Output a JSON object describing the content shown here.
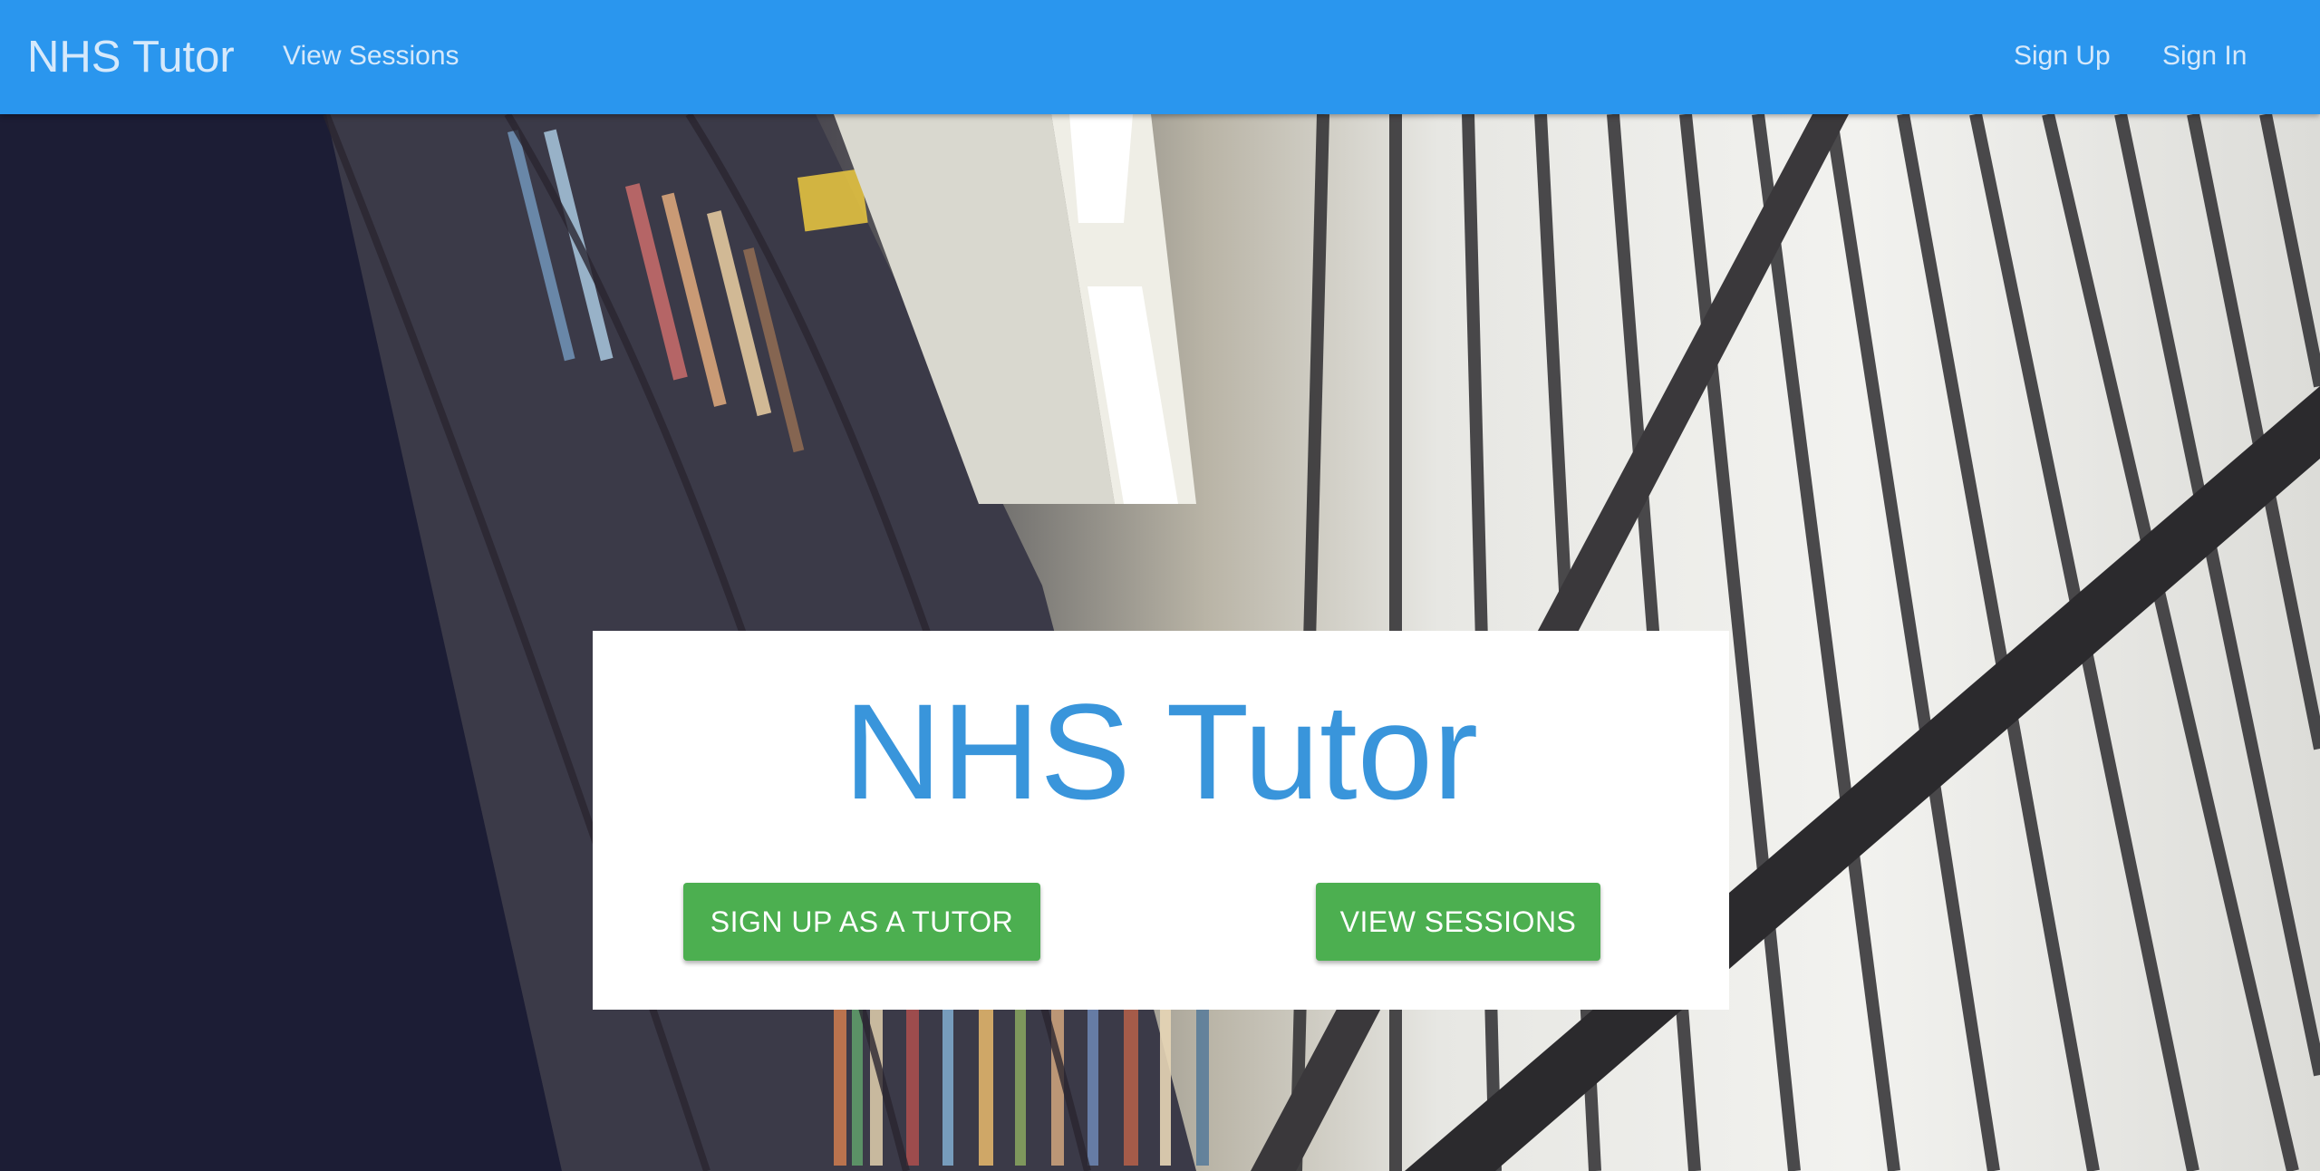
{
  "navbar": {
    "brand": "NHS Tutor",
    "links": {
      "view_sessions": "View Sessions",
      "sign_up": "Sign Up",
      "sign_in": "Sign In"
    }
  },
  "hero": {
    "background_description_icon": "library-bookshelves-photo",
    "card": {
      "title": "NHS Tutor",
      "buttons": {
        "signup_tutor": "SIGN UP AS A TUTOR",
        "view_sessions": "VIEW SESSIONS"
      }
    }
  },
  "colors": {
    "navbar": "#2a96ee",
    "title": "#3995db",
    "button": "#4caf50"
  }
}
